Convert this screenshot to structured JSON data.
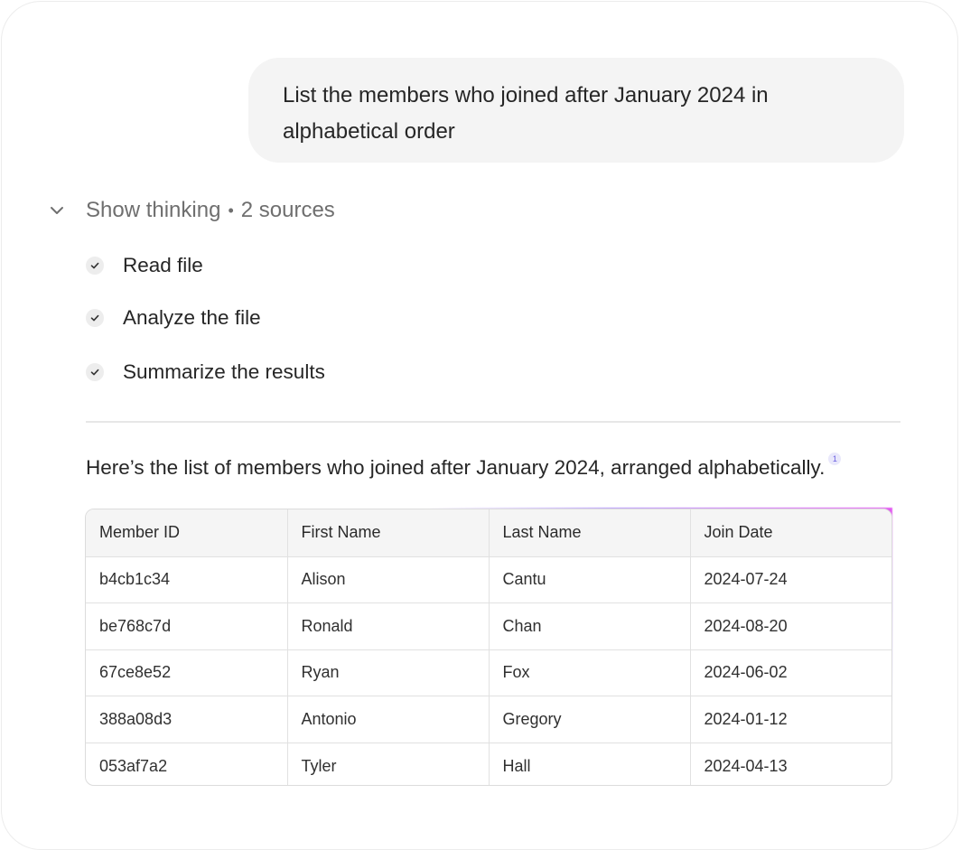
{
  "user_message": "List the members who joined after January 2024 in alphabetical order",
  "thinking": {
    "label": "Show thinking",
    "separator": "•",
    "sources": "2 sources",
    "toggle_icon": "chevron-down-icon",
    "steps": [
      {
        "label": "Read file",
        "status": "done",
        "icon": "check-icon"
      },
      {
        "label": "Analyze the file",
        "status": "done",
        "icon": "check-icon"
      },
      {
        "label": "Summarize the results",
        "status": "done",
        "icon": "check-icon"
      }
    ]
  },
  "answer": {
    "text": "Here’s the list of members who joined after January 2024, arranged alphabetically.",
    "citation": "1"
  },
  "table": {
    "headers": [
      "Member ID",
      "First Name",
      "Last Name",
      "Join Date"
    ],
    "rows": [
      [
        "b4cb1c34",
        "Alison",
        "Cantu",
        "2024-07-24"
      ],
      [
        "be768c7d",
        "Ronald",
        "Chan",
        "2024-08-20"
      ],
      [
        "67ce8e52",
        "Ryan",
        "Fox",
        "2024-06-02"
      ],
      [
        "388a08d3",
        "Antonio",
        "Gregory",
        "2024-01-12"
      ],
      [
        "053af7a2",
        "Tyler",
        "Hall",
        "2024-04-13"
      ]
    ]
  },
  "colors": {
    "accent_glow_start": "#b59af7",
    "accent_glow_end": "#e25cf0",
    "citation": "#6a5ee0"
  }
}
